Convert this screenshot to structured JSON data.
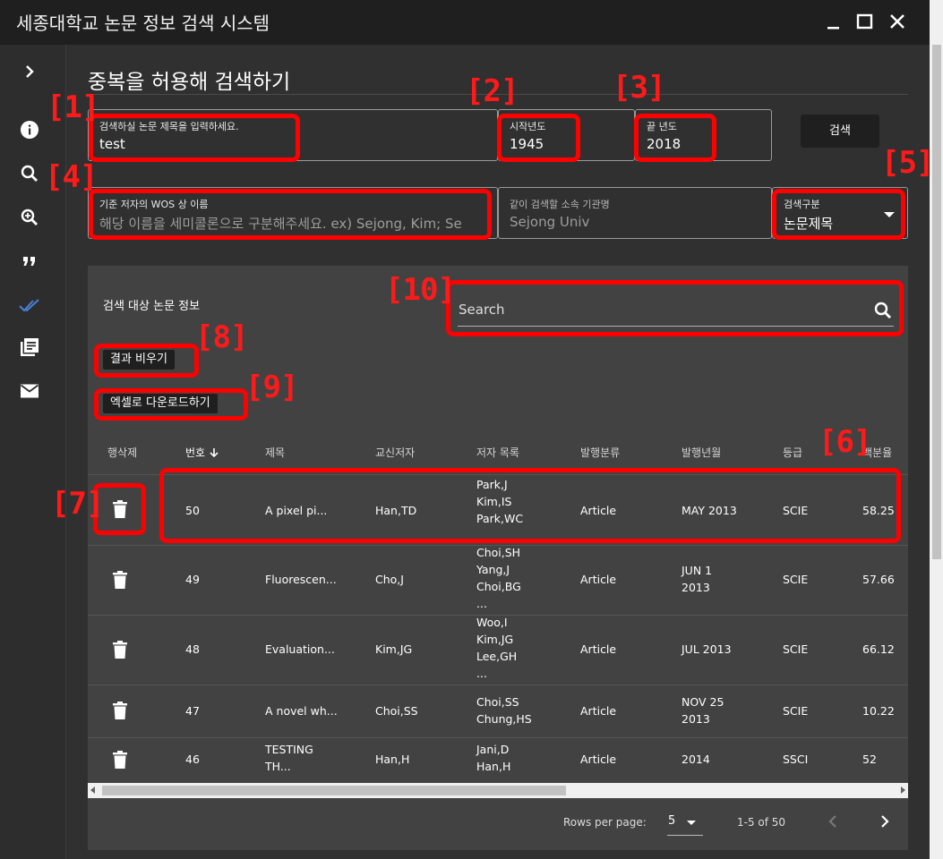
{
  "window": {
    "title": "세종대학교 논문 정보 검색 시스템"
  },
  "nav": {
    "icons": [
      "chevron-right-icon",
      "info-icon",
      "search-icon",
      "zoom-in-icon",
      "quote-icon",
      "double-check-icon",
      "library-books-icon",
      "mail-icon"
    ]
  },
  "page": {
    "title": "중복을 허용해 검색하기"
  },
  "form": {
    "title_label": "검색하실 논문 제목을 입력하세요.",
    "title_value": "test",
    "start_label": "시작년도",
    "start_value": "1945",
    "end_label": "끝 년도",
    "end_value": "2018",
    "search_button": "검색",
    "author_label": "기준 저자의 WOS 상 이름",
    "author_placeholder": "해당 이름을 세미콜론으로 구분해주세요. ex) Sejong, Kim; Se",
    "affil_label": "같이 검색할 소속 기관명",
    "affil_placeholder": "Sejong Univ",
    "category_label": "검색구분",
    "category_value": "논문제목"
  },
  "panel": {
    "title": "검색 대상 논문 정보",
    "search_placeholder": "Search",
    "clear_button": "결과 비우기",
    "excel_button": "엑셀로 다운로드하기"
  },
  "table": {
    "headers": [
      "행삭제",
      "번호",
      "제목",
      "교신저자",
      "저자 목록",
      "발행분류",
      "발행년월",
      "등급",
      "백분율"
    ],
    "rows": [
      {
        "num": "50",
        "title": "A pixel pi...",
        "corr": "Han,TD",
        "authors": [
          "Park,J",
          "Kim,IS",
          "Park,WC"
        ],
        "type": "Article",
        "date": [
          "MAY 2013"
        ],
        "grade": "SCIE",
        "pct": "58.25"
      },
      {
        "num": "49",
        "title": "Fluorescen...",
        "corr": "Cho,J",
        "authors": [
          "Choi,SH",
          "Yang,J",
          "Choi,BG",
          "..."
        ],
        "type": "Article",
        "date": [
          "JUN 1",
          "2013"
        ],
        "grade": "SCIE",
        "pct": "57.66"
      },
      {
        "num": "48",
        "title": "Evaluation...",
        "corr": "Kim,JG",
        "authors": [
          "Woo,I",
          "Kim,JG",
          "Lee,GH",
          "..."
        ],
        "type": "Article",
        "date": [
          "JUL 2013"
        ],
        "grade": "SCIE",
        "pct": "66.12"
      },
      {
        "num": "47",
        "title": "A novel wh...",
        "corr": "Choi,SS",
        "authors": [
          "Choi,SS",
          "Chung,HS"
        ],
        "type": "Article",
        "date": [
          "NOV 25",
          "2013"
        ],
        "grade": "SCIE",
        "pct": "10.22"
      },
      {
        "num": "46",
        "title": [
          "TESTING",
          "TH..."
        ],
        "corr": "Han,H",
        "authors": [
          "Jani,D",
          "Han,H"
        ],
        "type": "Article",
        "date": [
          "2014"
        ],
        "grade": "SSCI",
        "pct": "52"
      }
    ]
  },
  "pager": {
    "rows_label": "Rows per page:",
    "rows_value": "5",
    "range": "1-5 of 50"
  },
  "annotations": [
    "[1]",
    "[2]",
    "[3]",
    "[4]",
    "[5]",
    "[6]",
    "[7]",
    "[8]",
    "[9]",
    "[10]"
  ],
  "colors": {
    "annotation": "#ff0000",
    "accent": "#4a7fd6"
  }
}
